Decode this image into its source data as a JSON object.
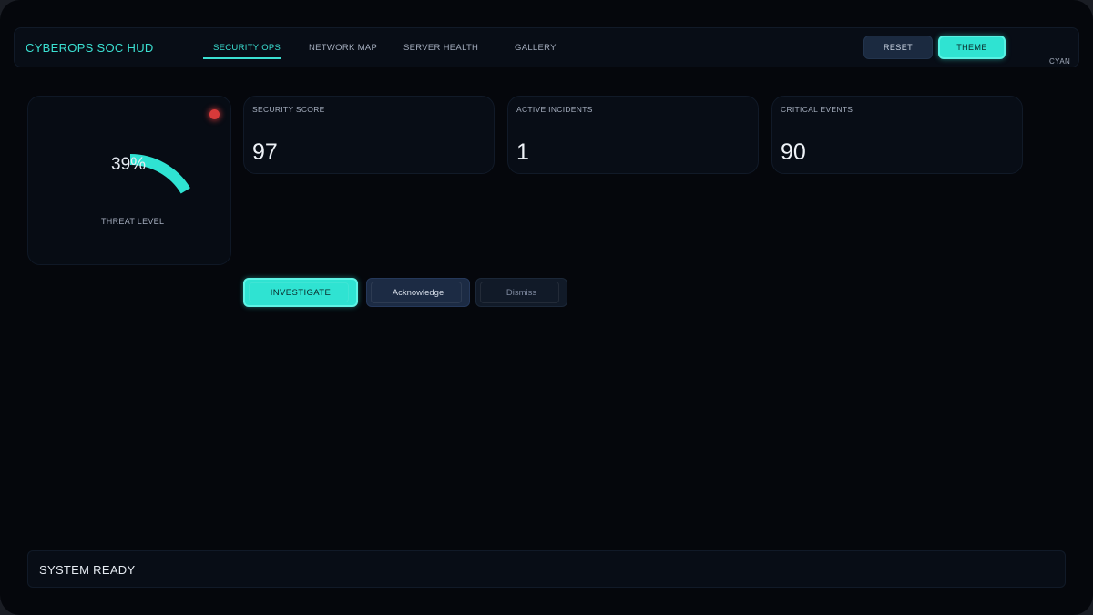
{
  "app": {
    "title": "CYBEROPS SOC HUD"
  },
  "nav": {
    "items": [
      {
        "label": "SECURITY OPS",
        "active": true
      },
      {
        "label": "NETWORK MAP",
        "active": false
      },
      {
        "label": "SERVER HEALTH",
        "active": false
      },
      {
        "label": "GALLERY",
        "active": false
      }
    ]
  },
  "toolbar": {
    "reset_label": "RESET",
    "theme_label": "THEME",
    "theme_value": "CYAN"
  },
  "gauge": {
    "value_text": "39%",
    "value": 39,
    "label": "THREAT LEVEL",
    "alert_icon": "alert-dot-icon"
  },
  "stats": [
    {
      "label": "SECURITY SCORE",
      "value": "97"
    },
    {
      "label": "ACTIVE INCIDENTS",
      "value": "1"
    },
    {
      "label": "CRITICAL EVENTS",
      "value": "90"
    }
  ],
  "actions": {
    "investigate_label": "INVESTIGATE",
    "acknowledge_label": "Acknowledge",
    "dismiss_label": "Dismiss"
  },
  "status": {
    "text": "SYSTEM READY"
  },
  "colors": {
    "accent": "#2fe3d2",
    "background": "#05070c",
    "alert": "#d83a3a"
  }
}
